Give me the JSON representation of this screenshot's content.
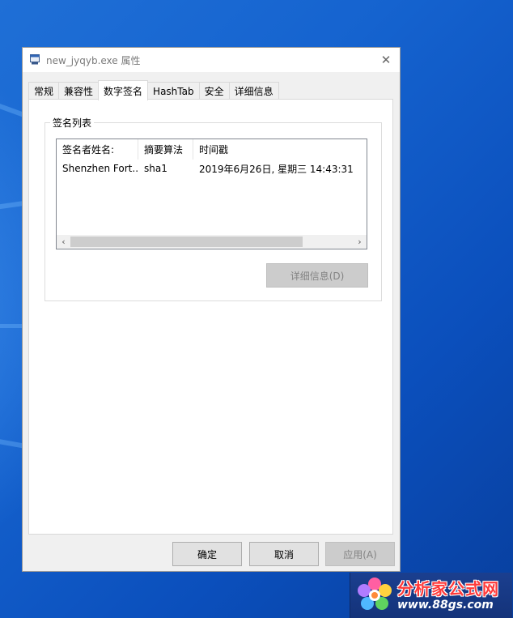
{
  "window": {
    "title": "new_jyqyb.exe 属性",
    "close_glyph": "✕"
  },
  "tabs": [
    {
      "label": "常规",
      "active": false
    },
    {
      "label": "兼容性",
      "active": false
    },
    {
      "label": "数字签名",
      "active": true
    },
    {
      "label": "HashTab",
      "active": false
    },
    {
      "label": "安全",
      "active": false
    },
    {
      "label": "详细信息",
      "active": false
    }
  ],
  "signature_group": {
    "title": "签名列表",
    "columns": [
      "签名者姓名:",
      "摘要算法",
      "时间戳"
    ],
    "rows": [
      [
        "Shenzhen Fort...",
        "sha1",
        "2019年6月26日, 星期三 14:43:31"
      ]
    ],
    "scroll_left": "‹",
    "scroll_right": "›",
    "details_button": "详细信息(D)"
  },
  "footer": {
    "ok": "确定",
    "cancel": "取消",
    "apply": "应用(A)"
  },
  "watermark": {
    "name": "分析家公式网",
    "url": "www.88gs.com"
  },
  "colors": {
    "desktop": "#1563cf",
    "window_bg": "#f0f0f0",
    "button_bg": "#e1e1e1",
    "watermark_bg": "#1b3f8f",
    "watermark_text": "#ff3a3a"
  }
}
